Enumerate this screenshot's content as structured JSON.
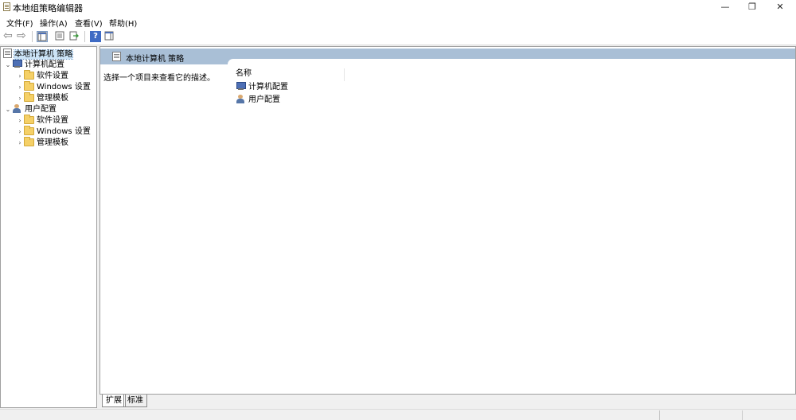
{
  "window": {
    "title": "本地组策略编辑器",
    "minimize": "—",
    "restore": "❐",
    "close": "✕"
  },
  "menu": [
    "文件(F)",
    "操作(A)",
    "查看(V)",
    "帮助(H)"
  ],
  "toolbar": {
    "back_icon": "⇦",
    "forward_icon": "⇨",
    "help_icon": "?"
  },
  "tree": {
    "root": "本地计算机 策略",
    "computer_config": "计算机配置",
    "user_config": "用户配置",
    "software_settings": "软件设置",
    "windows_settings": "Windows 设置",
    "admin_templates": "管理模板",
    "expanded_glyph": "⌄",
    "collapsed_glyph": "›"
  },
  "content": {
    "header_title": "本地计算机 策略",
    "description": "选择一个项目来查看它的描述。",
    "column_name": "名称",
    "items": [
      "计算机配置",
      "用户配置"
    ]
  },
  "tabs": {
    "extended": "扩展",
    "standard": "标准"
  },
  "colors": {
    "header_band": "#a9bfd6",
    "folder": "#f5d067",
    "selection": "#cce4f7"
  }
}
